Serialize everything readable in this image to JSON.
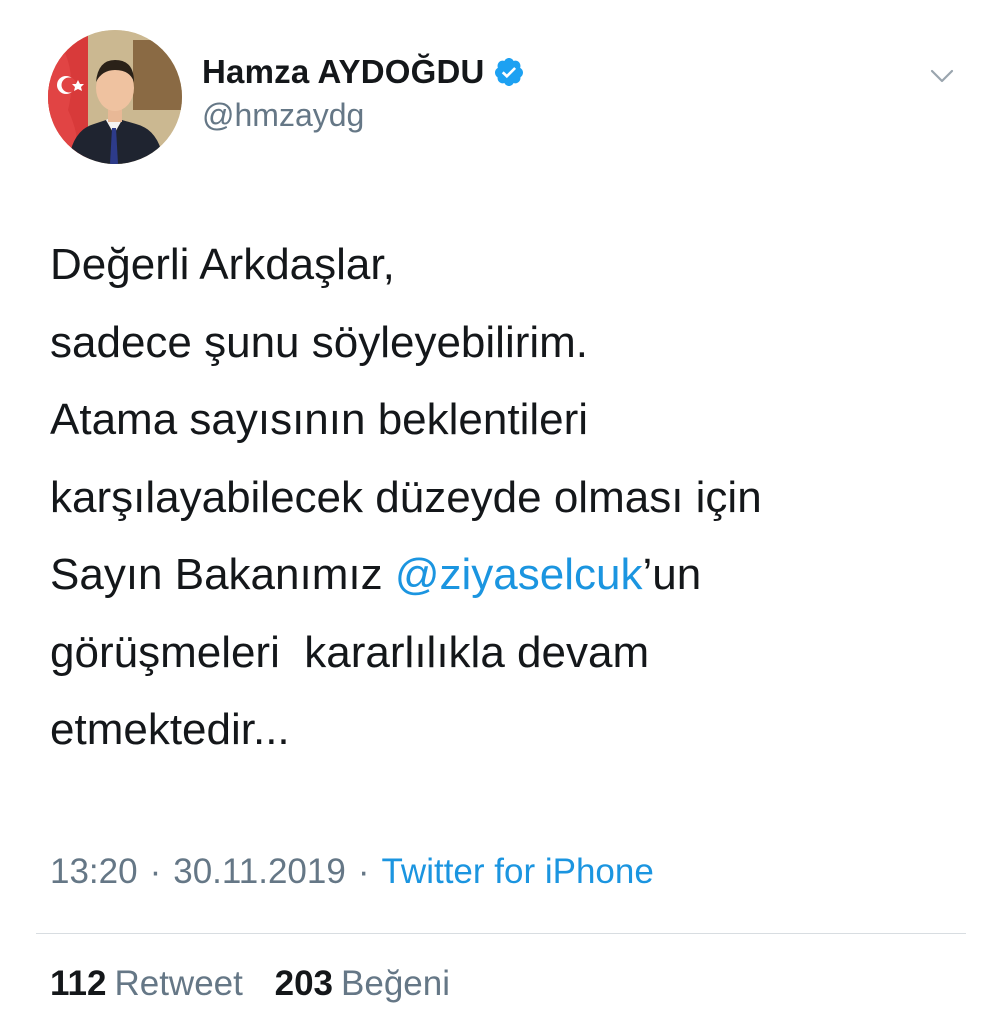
{
  "author": {
    "display_name": "Hamza AYDOĞDU",
    "handle": "@hmzaydg",
    "verified": true
  },
  "icons": {
    "avatar": "profile-photo",
    "verified": "verified-badge-icon",
    "menu": "chevron-down-icon"
  },
  "tweet": {
    "lines": [
      {
        "text": "Değerli Arkdaşlar,"
      },
      {
        "text": "sadece şunu söyleyebilirim."
      },
      {
        "text": "Atama sayısının beklentileri"
      },
      {
        "text": "karşılayabilecek düzeyde olması için"
      },
      {
        "before": "Sayın Bakanımız ",
        "mention": "@ziyaselcuk",
        "after": "’un"
      },
      {
        "text": "görüşmeleri  kararlılıkla devam"
      },
      {
        "text": "etmektedir..."
      }
    ]
  },
  "meta": {
    "time": "13:20",
    "separator": "·",
    "date": "30.11.2019",
    "source": "Twitter for iPhone"
  },
  "stats": {
    "retweets_count": "112",
    "retweets_label": "Retweet",
    "likes_count": "203",
    "likes_label": "Beğeni"
  },
  "colors": {
    "link": "#1b95e0",
    "secondary_text": "#657786",
    "primary_text": "#14171a",
    "verified_badge": "#1da1f2",
    "divider": "#d8dde1"
  }
}
